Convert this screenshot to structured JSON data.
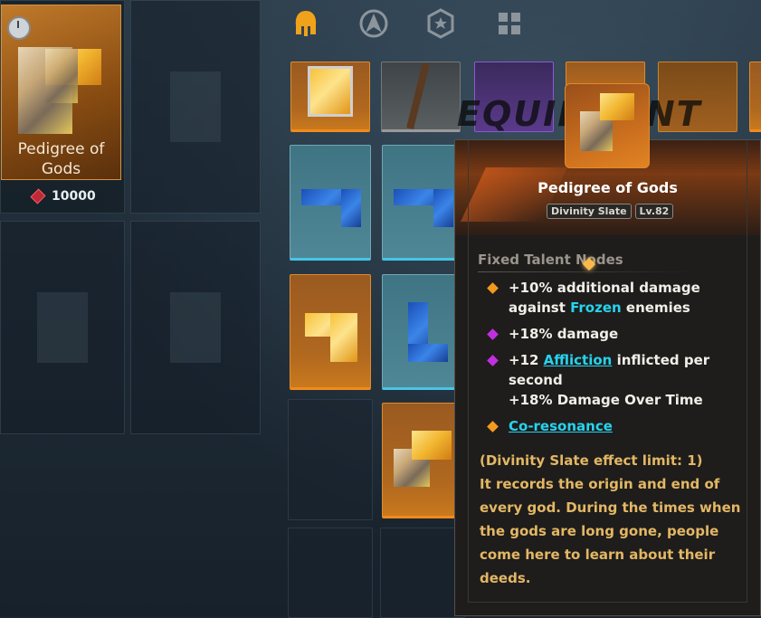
{
  "featured_item": {
    "name": "Pedigree of Gods",
    "price": "10000",
    "currency_icon": "red-gem-icon"
  },
  "nav": {
    "icons": [
      "helmet-icon",
      "compass-a-icon",
      "star-shield-icon",
      "grid-icon"
    ],
    "active_color": "#f0a21a"
  },
  "banner": {
    "text": "EQUIPMENT"
  },
  "tooltip": {
    "title": "Pedigree of Gods",
    "tag_type": "Divinity Slate",
    "tag_level": "Lv.82",
    "section_title": "Fixed Talent Nodes",
    "nodes": [
      {
        "bullet": "orange",
        "line1_pre": "+10% additional damage",
        "line2_pre": "against ",
        "keyword": "Frozen",
        "line2_post": " enemies"
      },
      {
        "bullet": "purple",
        "text": "+18% damage"
      },
      {
        "bullet": "purple",
        "pre": "+12 ",
        "keyword": "Affliction",
        "post": " inflicted per",
        "line2": "second",
        "line3": "+18% Damage Over Time"
      },
      {
        "bullet": "orange",
        "keyword": "Co-resonance"
      }
    ],
    "description": "(Divinity Slate effect limit: 1)\nIt records the origin and end of every god. During the times when the gods are long gone, people come here to learn about their deeds."
  },
  "colors": {
    "keyword": "#26d3ef",
    "description": "#e3b765",
    "orange_bullet": "#f39a1e",
    "purple_bullet": "#c22fe0"
  }
}
